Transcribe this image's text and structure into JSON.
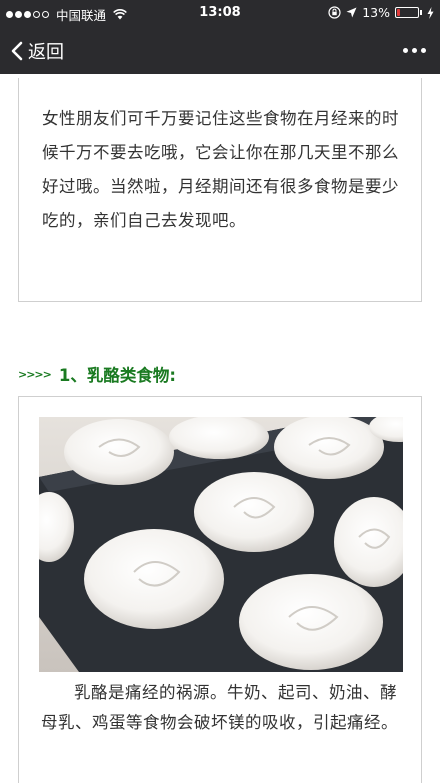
{
  "status_bar": {
    "carrier": "中国联通",
    "time": "13:08",
    "battery_percent": "13%",
    "battery_level": 0.13,
    "colors": {
      "battery_low": "#e23b3b"
    },
    "icons": [
      "signal-dots-icon",
      "wifi-icon",
      "orientation-lock-icon",
      "location-arrow-icon",
      "battery-icon",
      "charging-icon"
    ]
  },
  "nav": {
    "back_label": "返回",
    "icons": [
      "chevron-left-icon",
      "more-dots-icon"
    ]
  },
  "article": {
    "intro": "女性朋友们可千万要记住这些食物在月经来的时候千万不要去吃哦，它会让你在那几天里不那么好过哦。当然啦，月经期间还有很多食物是要少吃的，亲们自己去发现吧。",
    "section_arrows": ">>>>",
    "section_title": "1、乳酪类食物:",
    "section_color": "#1a7a21",
    "section_body": "乳酪是痛经的祸源。牛奶、起司、奶油、酵母乳、鸡蛋等食物会破坏镁的吸收，引起痛经。"
  }
}
